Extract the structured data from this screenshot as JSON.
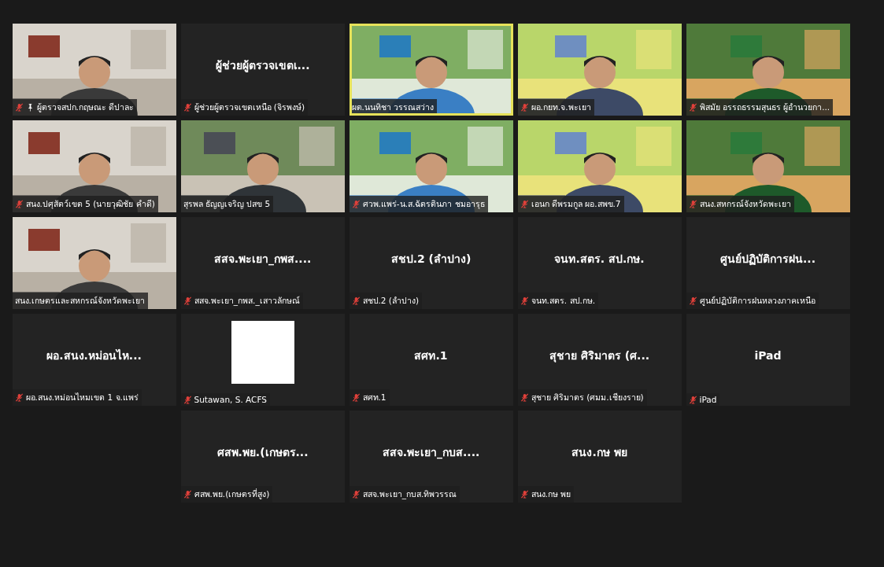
{
  "rows": [
    {
      "tiles": [
        {
          "kind": "video",
          "label": "ผู้ตรวจสปก.กฤษณะ ดีปาละ",
          "muted": true,
          "pinned": true,
          "speaking": false
        },
        {
          "kind": "name",
          "title": "ผู้ช่วยผู้ตรวจเขตเ...",
          "label": "ผู้ช่วยผู้ตรวจเขตเหนือ (จิรพงษ์)",
          "muted": true,
          "pinned": false,
          "speaking": false
        },
        {
          "kind": "video",
          "label": "ผต.นนทิชา วรรณสว่าง",
          "muted": false,
          "pinned": false,
          "speaking": true
        },
        {
          "kind": "video",
          "label": "ผอ.กยท.จ.พะเยา",
          "muted": true,
          "pinned": false,
          "speaking": false
        },
        {
          "kind": "video",
          "label": "พิสมัย อรรถธรรมสุนธร ผู้อำนวยกา...",
          "muted": true,
          "pinned": false,
          "speaking": false
        }
      ]
    },
    {
      "tiles": [
        {
          "kind": "video",
          "label": "สนง.ปศุสัตว์เขต 5 (นายวุฒิชัย คำดี)",
          "muted": true,
          "pinned": false,
          "speaking": false
        },
        {
          "kind": "video",
          "label": "สุรพล ธัญญเจริญ ปสข 5",
          "muted": false,
          "pinned": false,
          "speaking": false
        },
        {
          "kind": "video",
          "label": "ศวพ.แพร่-น.ส.ฉัตรตินภา ชมอารุธ",
          "muted": true,
          "pinned": false,
          "speaking": false
        },
        {
          "kind": "video",
          "label": "เอนก ดีพรมกูล ผอ.สพข.7",
          "muted": true,
          "pinned": false,
          "speaking": false
        },
        {
          "kind": "video",
          "label": "สนง.สหกรณ์จังหวัดพะเยา",
          "muted": true,
          "pinned": false,
          "speaking": false
        }
      ]
    },
    {
      "tiles": [
        {
          "kind": "video",
          "label": "สนง.เกษตรและสหกรณ์จังหวัดพะเยา",
          "muted": false,
          "pinned": false,
          "speaking": false
        },
        {
          "kind": "name",
          "title": "สสจ.พะเยา_กพส....",
          "label": "สสจ.พะเยา_กพส._เสาวลักษณ์",
          "muted": true,
          "pinned": false,
          "speaking": false
        },
        {
          "kind": "name",
          "title": "สชป.2 (ลำปาง)",
          "label": "สชป.2 (ลำปาง)",
          "muted": true,
          "pinned": false,
          "speaking": false
        },
        {
          "kind": "name",
          "title": "จนท.สตร. สป.กษ.",
          "label": "จนท.สตร. สป.กษ.",
          "muted": true,
          "pinned": false,
          "speaking": false
        },
        {
          "kind": "name",
          "title": "ศูนย์ปฏิบัติการฝน...",
          "label": "ศูนย์ปฏิบัติการฝนหลวงภาคเหนือ",
          "muted": true,
          "pinned": false,
          "speaking": false
        }
      ]
    },
    {
      "tiles": [
        {
          "kind": "name",
          "title": "ผอ.สนง.หม่อนไห...",
          "label": "ผอ.สนง.หม่อนไหมเขต 1 จ.แพร่",
          "muted": true,
          "pinned": false,
          "speaking": false
        },
        {
          "kind": "blank",
          "label": "Sutawan, S. ACFS",
          "muted": true,
          "pinned": false,
          "speaking": false
        },
        {
          "kind": "name",
          "title": "สศท.1",
          "label": "สศท.1",
          "muted": true,
          "pinned": false,
          "speaking": false
        },
        {
          "kind": "name",
          "title": "สุชาย ศิริมาตร (ศ...",
          "label": "สุชาย ศิริมาตร (ศมม.เชียงราย)",
          "muted": true,
          "pinned": false,
          "speaking": false
        },
        {
          "kind": "name",
          "title": "iPad",
          "label": "iPad",
          "muted": true,
          "pinned": false,
          "speaking": false
        }
      ]
    },
    {
      "tiles": [
        {
          "kind": "name",
          "title": "ศสพ.พย.(เกษตร...",
          "label": "ศสพ.พย.(เกษตรที่สูง)",
          "muted": true,
          "pinned": false,
          "speaking": false
        },
        {
          "kind": "name",
          "title": "สสจ.พะเยา_กบส....",
          "label": "สสจ.พะเยา_กบส.ทิพวรรณ",
          "muted": true,
          "pinned": false,
          "speaking": false
        },
        {
          "kind": "name",
          "title": "สนง.กษ พย",
          "label": "สนง.กษ พย",
          "muted": true,
          "pinned": false,
          "speaking": false
        }
      ]
    }
  ]
}
